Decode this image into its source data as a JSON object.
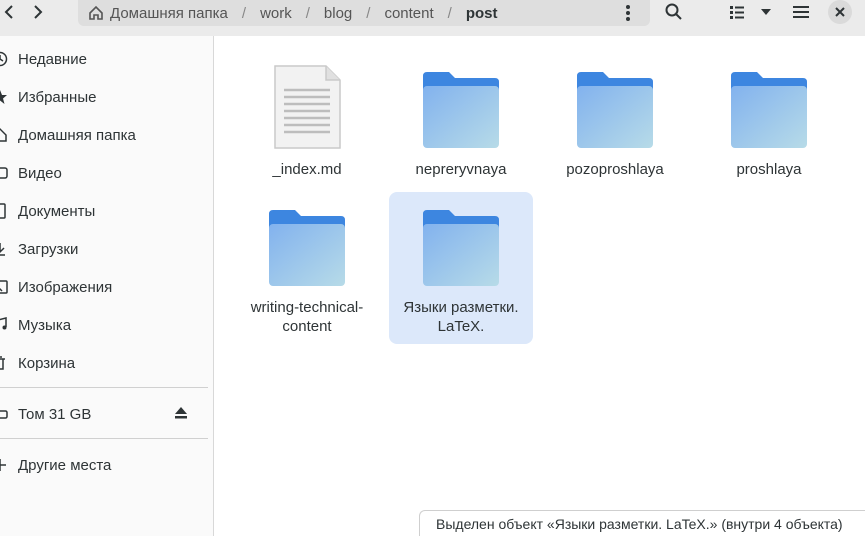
{
  "breadcrumb": {
    "items": [
      {
        "label": "Домашняя папка"
      },
      {
        "label": "work"
      },
      {
        "label": "blog"
      },
      {
        "label": "content"
      },
      {
        "label": "post"
      }
    ]
  },
  "sidebar": {
    "items": [
      {
        "label": "Недавние",
        "icon": "clock-icon"
      },
      {
        "label": "Избранные",
        "icon": "star-icon"
      },
      {
        "label": "Домашняя папка",
        "icon": "home-icon"
      },
      {
        "label": "Видео",
        "icon": "video-icon"
      },
      {
        "label": "Документы",
        "icon": "document-icon"
      },
      {
        "label": "Загрузки",
        "icon": "download-icon"
      },
      {
        "label": "Изображения",
        "icon": "image-icon"
      },
      {
        "label": "Музыка",
        "icon": "music-icon"
      },
      {
        "label": "Корзина",
        "icon": "trash-icon"
      }
    ],
    "volume": {
      "label": "Том 31 GB",
      "icon": "drive-icon"
    },
    "other": {
      "label": "Другие места",
      "icon": "plus-icon"
    }
  },
  "files": [
    {
      "name": "_index.md",
      "type": "document"
    },
    {
      "name": "nepreryvnaya",
      "type": "folder"
    },
    {
      "name": "pozoproshlaya",
      "type": "folder"
    },
    {
      "name": "proshlaya",
      "type": "folder"
    },
    {
      "name": "writing-technical-content",
      "type": "folder"
    },
    {
      "name": "Языки разметки. LaTeX.",
      "type": "folder",
      "selected": true
    }
  ],
  "status": {
    "text": "Выделен объект «Языки разметки. LaTeX.» (внутри 4 объекта)"
  },
  "colors": {
    "folder_top": "#3d86e0",
    "folder_body": "#8fbcf0",
    "selection": "#dce8fa"
  }
}
